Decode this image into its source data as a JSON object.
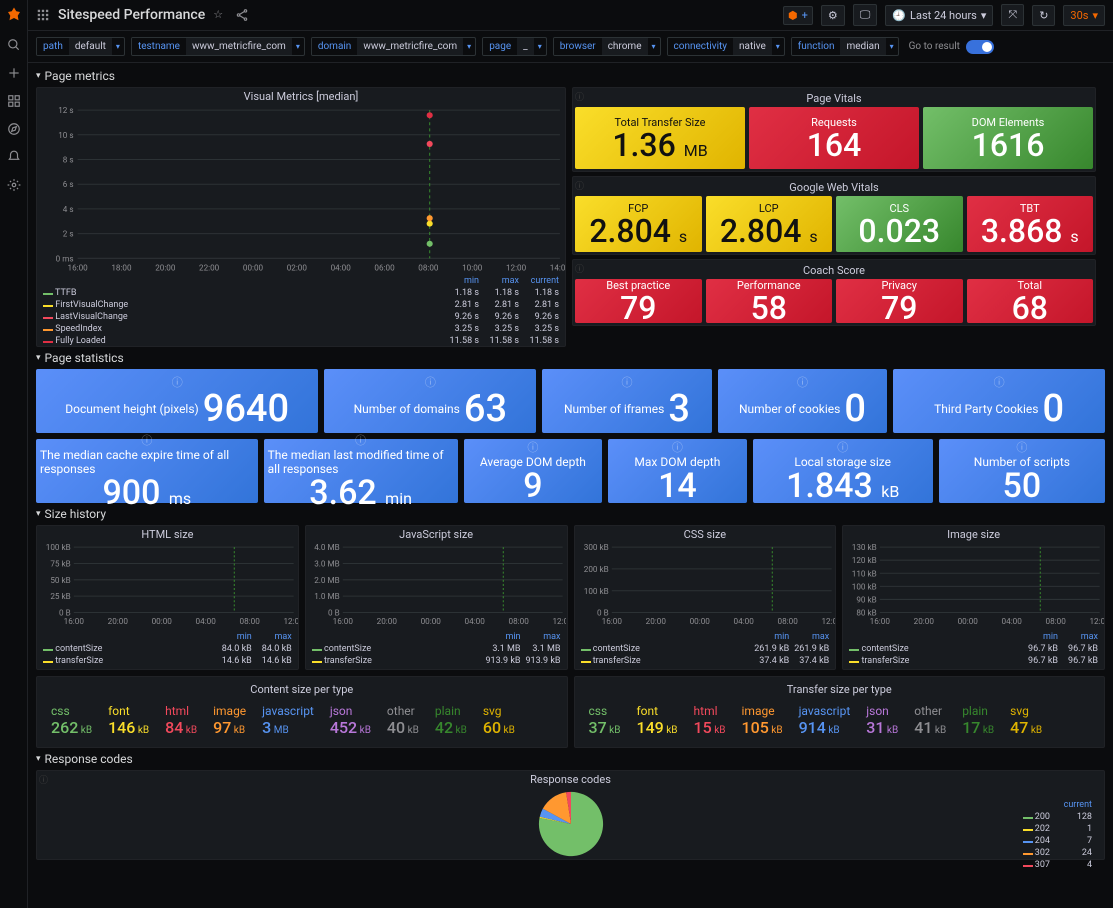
{
  "header": {
    "title": "Sitespeed Performance",
    "timeRange": "Last 24 hours",
    "refresh": "30s"
  },
  "vars": [
    {
      "label": "path",
      "value": "default"
    },
    {
      "label": "testname",
      "value": "www_metricfire_com"
    },
    {
      "label": "domain",
      "value": "www_metricfire_com"
    },
    {
      "label": "page",
      "value": "_"
    },
    {
      "label": "browser",
      "value": "chrome"
    },
    {
      "label": "connectivity",
      "value": "native"
    },
    {
      "label": "function",
      "value": "median"
    }
  ],
  "goToResult": "Go to result",
  "rows": {
    "pageMetrics": "Page metrics",
    "pageStats": "Page statistics",
    "sizeHistory": "Size history",
    "responseCodes": "Response codes"
  },
  "visualMetrics": {
    "title": "Visual Metrics [median]",
    "yticks": [
      "0 ms",
      "2 s",
      "4 s",
      "6 s",
      "8 s",
      "10 s",
      "12 s"
    ],
    "xticks": [
      "16:00",
      "18:00",
      "20:00",
      "22:00",
      "00:00",
      "02:00",
      "04:00",
      "06:00",
      "08:00",
      "10:00",
      "12:00",
      "14:00"
    ],
    "headers": [
      "min",
      "max",
      "current"
    ],
    "series": [
      {
        "name": "TTFB",
        "color": "#73bf69",
        "min": "1.18 s",
        "max": "1.18 s",
        "current": "1.18 s"
      },
      {
        "name": "FirstVisualChange",
        "color": "#fade2a",
        "min": "2.81 s",
        "max": "2.81 s",
        "current": "2.81 s"
      },
      {
        "name": "LastVisualChange",
        "color": "#f2495c",
        "min": "9.26 s",
        "max": "9.26 s",
        "current": "9.26 s"
      },
      {
        "name": "SpeedIndex",
        "color": "#ff9830",
        "min": "3.25 s",
        "max": "3.25 s",
        "current": "3.25 s"
      },
      {
        "name": "Fully Loaded",
        "color": "#e02f44",
        "min": "11.58 s",
        "max": "11.58 s",
        "current": "11.58 s"
      }
    ]
  },
  "pageVitals": {
    "title": "Page Vitals",
    "items": [
      {
        "label": "Total Transfer Size",
        "value": "1.36",
        "unit": "MB",
        "style": "yellow"
      },
      {
        "label": "Requests",
        "value": "164",
        "unit": "",
        "style": "red"
      },
      {
        "label": "DOM Elements",
        "value": "1616",
        "unit": "",
        "style": "green"
      }
    ]
  },
  "googleVitals": {
    "title": "Google Web Vitals",
    "items": [
      {
        "label": "FCP",
        "value": "2.804",
        "unit": "s",
        "style": "yellow"
      },
      {
        "label": "LCP",
        "value": "2.804",
        "unit": "s",
        "style": "yellow"
      },
      {
        "label": "CLS",
        "value": "0.023",
        "unit": "",
        "style": "green"
      },
      {
        "label": "TBT",
        "value": "3.868",
        "unit": "s",
        "style": "red"
      }
    ]
  },
  "coach": {
    "title": "Coach Score",
    "items": [
      {
        "label": "Best practice",
        "value": "79",
        "style": "red"
      },
      {
        "label": "Performance",
        "value": "58",
        "style": "red"
      },
      {
        "label": "Privacy",
        "value": "79",
        "style": "red"
      },
      {
        "label": "Total",
        "value": "68",
        "style": "red"
      }
    ]
  },
  "pageStats1": [
    {
      "label": "Document height (pixels)",
      "value": "9640"
    },
    {
      "label": "Number of domains",
      "value": "63"
    },
    {
      "label": "Number of iframes",
      "value": "3"
    },
    {
      "label": "Number of cookies",
      "value": "0"
    },
    {
      "label": "Third Party Cookies",
      "value": "0"
    }
  ],
  "pageStats2": [
    {
      "label": "The median cache expire time of all responses",
      "value": "900",
      "unit": "ms"
    },
    {
      "label": "The median last modified time of all responses",
      "value": "3.62",
      "unit": "min"
    },
    {
      "label": "Average DOM depth",
      "value": "9",
      "unit": ""
    },
    {
      "label": "Max DOM depth",
      "value": "14",
      "unit": ""
    },
    {
      "label": "Local storage size",
      "value": "1.843",
      "unit": "kB"
    },
    {
      "label": "Number of scripts",
      "value": "50",
      "unit": ""
    }
  ],
  "sizeCharts": [
    {
      "title": "HTML size",
      "yticks": [
        "0 B",
        "25 kB",
        "50 kB",
        "75 kB",
        "100 kB"
      ],
      "series": [
        {
          "name": "contentSize",
          "min": "84.0 kB",
          "max": "84.0 kB",
          "color": "#73bf69"
        },
        {
          "name": "transferSize",
          "min": "14.6 kB",
          "max": "14.6 kB",
          "color": "#fade2a"
        }
      ]
    },
    {
      "title": "JavaScript size",
      "yticks": [
        "0 B",
        "1.0 MB",
        "2.0 MB",
        "3.0 MB",
        "4.0 MB"
      ],
      "series": [
        {
          "name": "contentSize",
          "min": "3.1 MB",
          "max": "3.1 MB",
          "color": "#73bf69"
        },
        {
          "name": "transferSize",
          "min": "913.9 kB",
          "max": "913.9 kB",
          "color": "#fade2a"
        }
      ]
    },
    {
      "title": "CSS size",
      "yticks": [
        "0 B",
        "100 kB",
        "200 kB",
        "300 kB"
      ],
      "series": [
        {
          "name": "contentSize",
          "min": "261.9 kB",
          "max": "261.9 kB",
          "color": "#73bf69"
        },
        {
          "name": "transferSize",
          "min": "37.4 kB",
          "max": "37.4 kB",
          "color": "#fade2a"
        }
      ]
    },
    {
      "title": "Image size",
      "yticks": [
        "80 kB",
        "90 kB",
        "100 kB",
        "110 kB",
        "120 kB",
        "130 kB"
      ],
      "series": [
        {
          "name": "contentSize",
          "min": "96.7 kB",
          "max": "96.7 kB",
          "color": "#73bf69"
        },
        {
          "name": "transferSize",
          "min": "96.7 kB",
          "max": "96.7 kB",
          "color": "#fade2a"
        }
      ]
    }
  ],
  "sizeXticks": [
    "16:00",
    "20:00",
    "00:00",
    "04:00",
    "08:00",
    "12:00"
  ],
  "sizeHeaders": [
    "min",
    "max"
  ],
  "contentTypes": {
    "title": "Content size per type",
    "items": [
      {
        "name": "css",
        "value": "262",
        "unit": "kB",
        "color": "#73bf69"
      },
      {
        "name": "font",
        "value": "146",
        "unit": "kB",
        "color": "#fade2a"
      },
      {
        "name": "html",
        "value": "84",
        "unit": "kB",
        "color": "#f2495c"
      },
      {
        "name": "image",
        "value": "97",
        "unit": "kB",
        "color": "#ff9830"
      },
      {
        "name": "javascript",
        "value": "3",
        "unit": "MB",
        "color": "#5794f2"
      },
      {
        "name": "json",
        "value": "452",
        "unit": "kB",
        "color": "#b877d9"
      },
      {
        "name": "other",
        "value": "40",
        "unit": "kB",
        "color": "#8e8e92"
      },
      {
        "name": "plain",
        "value": "42",
        "unit": "kB",
        "color": "#37872d"
      },
      {
        "name": "svg",
        "value": "60",
        "unit": "kB",
        "color": "#e0b400"
      }
    ]
  },
  "transferTypes": {
    "title": "Transfer size per type",
    "items": [
      {
        "name": "css",
        "value": "37",
        "unit": "kB",
        "color": "#73bf69"
      },
      {
        "name": "font",
        "value": "149",
        "unit": "kB",
        "color": "#fade2a"
      },
      {
        "name": "html",
        "value": "15",
        "unit": "kB",
        "color": "#f2495c"
      },
      {
        "name": "image",
        "value": "105",
        "unit": "kB",
        "color": "#ff9830"
      },
      {
        "name": "javascript",
        "value": "914",
        "unit": "kB",
        "color": "#5794f2"
      },
      {
        "name": "json",
        "value": "31",
        "unit": "kB",
        "color": "#b877d9"
      },
      {
        "name": "other",
        "value": "41",
        "unit": "kB",
        "color": "#8e8e92"
      },
      {
        "name": "plain",
        "value": "17",
        "unit": "kB",
        "color": "#37872d"
      },
      {
        "name": "svg",
        "value": "47",
        "unit": "kB",
        "color": "#e0b400"
      }
    ]
  },
  "responseCodes": {
    "title": "Response codes",
    "header": "current",
    "items": [
      {
        "code": "200",
        "value": 128,
        "color": "#73bf69"
      },
      {
        "code": "202",
        "value": 1,
        "color": "#fade2a"
      },
      {
        "code": "204",
        "value": 7,
        "color": "#5794f2"
      },
      {
        "code": "302",
        "value": 24,
        "color": "#ff9830"
      },
      {
        "code": "307",
        "value": 4,
        "color": "#f2495c"
      }
    ]
  },
  "chart_data": [
    {
      "type": "scatter",
      "title": "Visual Metrics [median]",
      "x": [
        "09:30"
      ],
      "series": [
        {
          "name": "TTFB",
          "values": [
            1.18
          ]
        },
        {
          "name": "FirstVisualChange",
          "values": [
            2.81
          ]
        },
        {
          "name": "LastVisualChange",
          "values": [
            9.26
          ]
        },
        {
          "name": "SpeedIndex",
          "values": [
            3.25
          ]
        },
        {
          "name": "Fully Loaded",
          "values": [
            11.58
          ]
        }
      ],
      "ylim": [
        0,
        12
      ],
      "ylabel": "seconds"
    },
    {
      "type": "line",
      "title": "HTML size",
      "series": [
        {
          "name": "contentSize",
          "values": [
            84.0
          ]
        },
        {
          "name": "transferSize",
          "values": [
            14.6
          ]
        }
      ],
      "ylim": [
        0,
        100
      ],
      "yunit": "kB"
    },
    {
      "type": "line",
      "title": "JavaScript size",
      "series": [
        {
          "name": "contentSize",
          "values": [
            3.1
          ]
        },
        {
          "name": "transferSize",
          "values": [
            0.914
          ]
        }
      ],
      "ylim": [
        0,
        4
      ],
      "yunit": "MB"
    },
    {
      "type": "line",
      "title": "CSS size",
      "series": [
        {
          "name": "contentSize",
          "values": [
            261.9
          ]
        },
        {
          "name": "transferSize",
          "values": [
            37.4
          ]
        }
      ],
      "ylim": [
        0,
        300
      ],
      "yunit": "kB"
    },
    {
      "type": "line",
      "title": "Image size",
      "series": [
        {
          "name": "contentSize",
          "values": [
            96.7
          ]
        },
        {
          "name": "transferSize",
          "values": [
            96.7
          ]
        }
      ],
      "ylim": [
        80,
        130
      ],
      "yunit": "kB"
    },
    {
      "type": "pie",
      "title": "Response codes",
      "categories": [
        "200",
        "202",
        "204",
        "302",
        "307"
      ],
      "values": [
        128,
        1,
        7,
        24,
        4
      ]
    }
  ]
}
